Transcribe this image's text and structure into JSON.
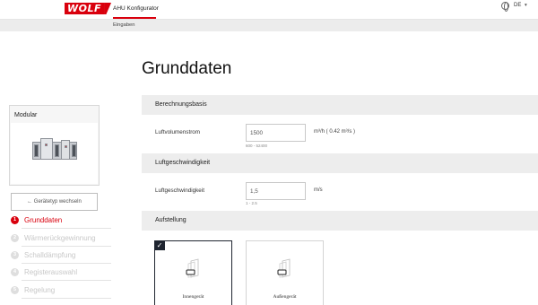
{
  "header": {
    "logo_text": "WOLF",
    "app_title": "AHU Konfigurator",
    "language": "DE"
  },
  "breadcrumb": {
    "label": "Eingaben"
  },
  "page": {
    "title": "Grunddaten"
  },
  "sidebar": {
    "card_title": "Modular",
    "switch_label": "← Gerätetyp wechseln",
    "steps": [
      {
        "number": "1",
        "label": "Grunddaten",
        "active": true
      },
      {
        "number": "2",
        "label": "Wärmerückgewinnung",
        "active": false
      },
      {
        "number": "3",
        "label": "Schalldämpfung",
        "active": false
      },
      {
        "number": "4",
        "label": "Registerauswahl",
        "active": false
      },
      {
        "number": "5",
        "label": "Regelung",
        "active": false
      }
    ]
  },
  "sections": {
    "basis": {
      "title": "Berechnungsbasis",
      "field_label": "Luftvolumenstrom",
      "value": "1500",
      "hint": "600 - 52400",
      "unit": "m³/h ( 0.42 m³/s )"
    },
    "velocity": {
      "title": "Luftgeschwindigkeit",
      "field_label": "Luftgeschwindigkeit",
      "value": "1,5",
      "hint": "1 - 2.5",
      "unit": "m/s"
    },
    "placement": {
      "title": "Aufstellung",
      "options": [
        {
          "label": "Innengerät",
          "selected": true
        },
        {
          "label": "Außengerät",
          "selected": false
        }
      ]
    }
  },
  "colors": {
    "accent": "#d9000d",
    "selected_border": "#1f2530",
    "section_bg": "#ededed"
  }
}
